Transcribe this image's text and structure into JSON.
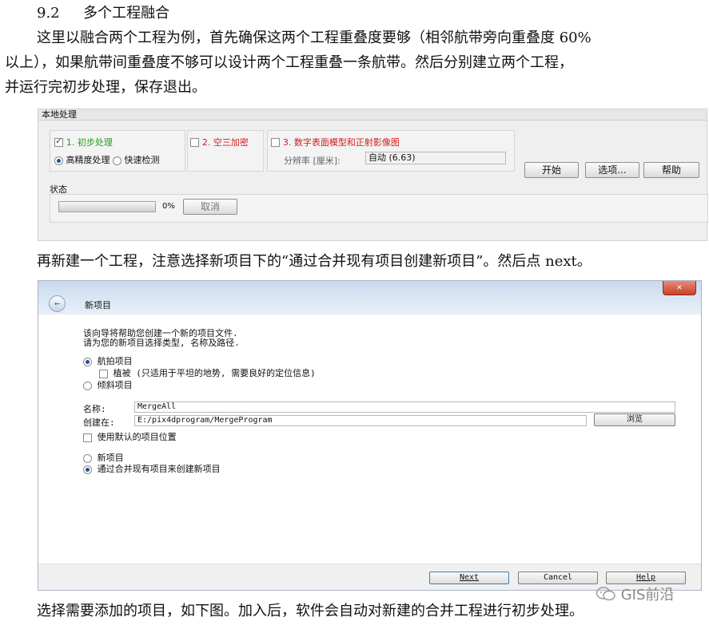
{
  "doc": {
    "heading_number": "9.2",
    "heading_title": "多个工程融合",
    "para1_line1": "这里以融合两个工程为例，首先确保这两个工程重叠度要够（相邻航带旁向重叠度 60%",
    "para1_line2": "以上），如果航带间重叠度不够可以设计两个工程重叠一条航带。然后分别建立两个工程，",
    "para1_line3": "并运行完初步处理，保存退出。",
    "para2": "再新建一个工程，注意选择新项目下的“通过合并现有项目创建新项目”。然后点 next。",
    "para3": "选择需要添加的项目，如下图。加入后，软件会自动对新建的合并工程进行初步处理。"
  },
  "panel": {
    "header": "本地处理",
    "step1_label": "1. 初步处理",
    "radio_high": "高精度处理",
    "radio_fast": "快速检测",
    "step2_label": "2. 空三加密",
    "step3_label": "3. 数字表面模型和正射影像图",
    "resolution_label": "分辨率 [厘米]:",
    "resolution_value": "自动 (6.63)",
    "start_button": "开始",
    "options_button": "选项...",
    "help_button": "帮助",
    "status_label": "状态",
    "progress_percent": "0%",
    "progress_value": 0,
    "cancel_button": "取消"
  },
  "wizard": {
    "close_glyph": "✕",
    "back_glyph": "←",
    "title": "新项目",
    "intro_line1": "该向导将帮助您创建一个新的项目文件.",
    "intro_line2": "请为您的新项目选择类型, 名称及路径.",
    "radio_aerial": "航拍项目",
    "check_vegetation": "植被 (只适用于平坦的地势, 需要良好的定位信息)",
    "radio_oblique": "倾斜项目",
    "name_label": "名称:",
    "name_value": "MergeAll",
    "create_in_label": "创建在:",
    "create_in_value": "E:/pix4dprogram/MergeProgram",
    "browse_button": "浏览",
    "check_default_location": "使用默认的项目位置",
    "radio_new_project": "新项目",
    "radio_merge": "通过合并现有项目来创建新项目",
    "next_button": "Next",
    "cancel_button": "Cancel",
    "help_button": "Help"
  },
  "watermark": {
    "icon": "wechat-icon",
    "text": "GIS前沿"
  }
}
